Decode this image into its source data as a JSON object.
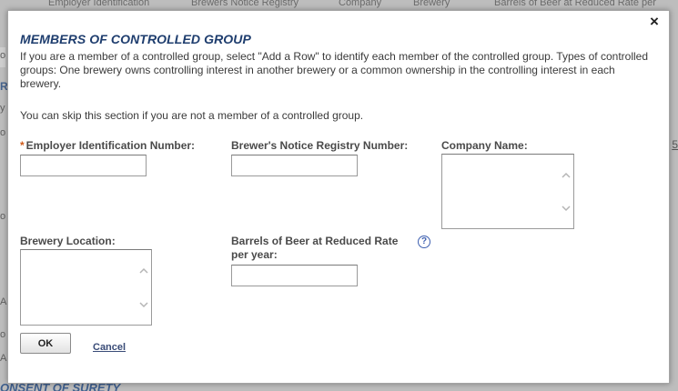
{
  "background": {
    "header_columns": [
      "Employer Identification",
      "Brewers Notice Registry",
      "Company",
      "Brewery",
      "Barrels of Beer at Reduced Rate per"
    ],
    "left_chars": [
      "o",
      "R",
      "y",
      "o",
      "o",
      "A",
      "o",
      "A"
    ],
    "right_number": "5",
    "bottom_heading": "ONSENT OF SURETY"
  },
  "modal": {
    "close_glyph": "×",
    "title": "MEMBERS OF CONTROLLED GROUP",
    "description": "If you are a member of a controlled group, select \"Add a Row\" to identify each member of the controlled group. Types of controlled groups: One brewery owns controlling interest in another brewery or a common ownership in the controlling interest in each brewery.",
    "skip_note": "You can skip this section if you are not a member of a controlled group.",
    "fields": {
      "ein": {
        "required_marker": "*",
        "label": "Employer Identification Number:",
        "value": ""
      },
      "registry": {
        "label": "Brewer's Notice Registry Number:",
        "value": ""
      },
      "company": {
        "label": "Company Name:",
        "value": ""
      },
      "location": {
        "label": "Brewery Location:",
        "value": ""
      },
      "barrels": {
        "label": "Barrels of Beer at Reduced Rate per year:",
        "value": ""
      }
    },
    "help_glyph": "?",
    "ok_label": "OK",
    "cancel_label": "Cancel"
  },
  "icons": {
    "close": "close-icon",
    "help": "help-icon",
    "scroll_up": "chevron-up-icon",
    "scroll_down": "chevron-down-icon"
  }
}
